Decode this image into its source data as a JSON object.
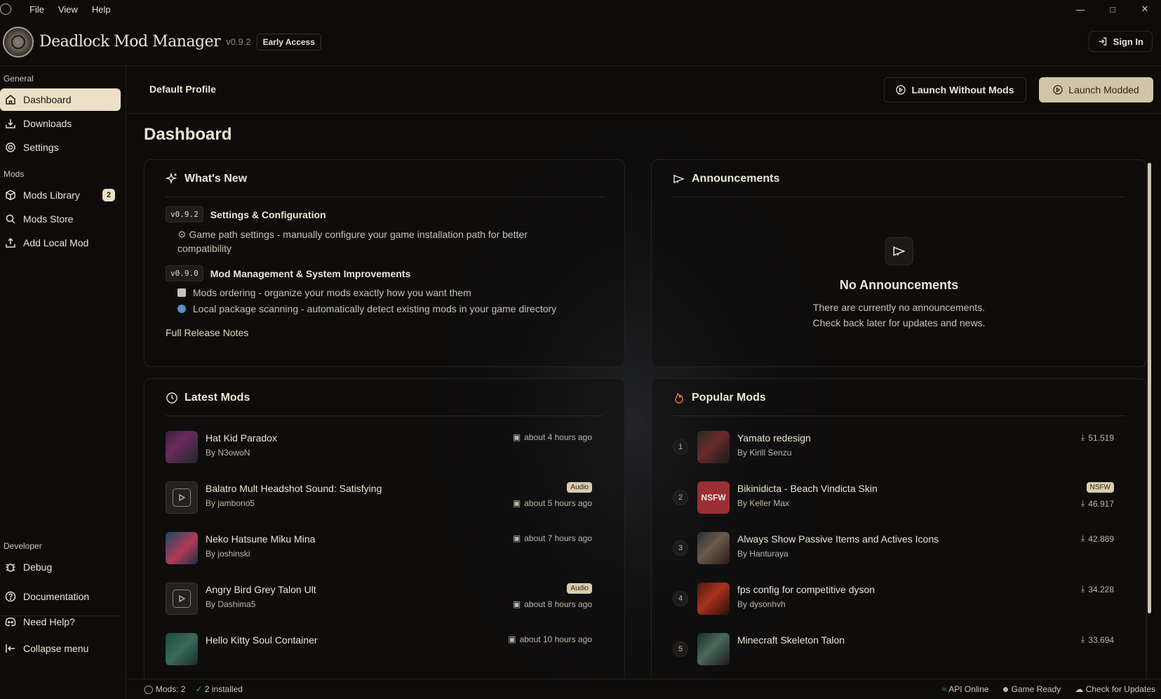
{
  "menu": {
    "file": "File",
    "view": "View",
    "help": "Help"
  },
  "header": {
    "title": "Deadlock Mod Manager",
    "version": "v0.9.2",
    "badge": "Early Access",
    "sign_in": "Sign In"
  },
  "sidebar": {
    "general_label": "General",
    "dashboard": "Dashboard",
    "downloads": "Downloads",
    "settings": "Settings",
    "mods_label": "Mods",
    "mods_library": "Mods Library",
    "mods_library_count": "2",
    "mods_store": "Mods Store",
    "add_local_mod": "Add Local Mod",
    "developer_label": "Developer",
    "debug": "Debug",
    "documentation": "Documentation",
    "need_help": "Need Help?",
    "collapse": "Collapse menu"
  },
  "profile": {
    "name": "Default Profile",
    "launch_without_mods": "Launch Without Mods",
    "launch_modded": "Launch Modded"
  },
  "page_title": "Dashboard",
  "whats_new": {
    "title": "What's New",
    "releases": [
      {
        "version": "v0.9.2",
        "title": "Settings & Configuration",
        "items": [
          "Game path settings - manually configure your game installation path for better compatibility"
        ]
      },
      {
        "version": "v0.9.0",
        "title": "Mod Management & System Improvements",
        "items": [
          "Mods ordering - organize your mods exactly how you want them",
          "Local package scanning - automatically detect existing mods in your game directory"
        ]
      }
    ],
    "link": "Full Release Notes"
  },
  "announcements": {
    "title": "Announcements",
    "empty_title": "No Announcements",
    "empty_line1": "There are currently no announcements.",
    "empty_line2": "Check back later for updates and news."
  },
  "latest_mods": {
    "title": "Latest Mods",
    "items": [
      {
        "name": "Hat Kid Paradox",
        "author": "By N3owoN",
        "time": "about 4 hours ago",
        "tag": ""
      },
      {
        "name": "Balatro Mult Headshot Sound: Satisfying",
        "author": "By jambono5",
        "time": "about 5 hours ago",
        "tag": "Audio"
      },
      {
        "name": "Neko Hatsune Miku Mina",
        "author": "By joshinski",
        "time": "about 7 hours ago",
        "tag": ""
      },
      {
        "name": "Angry Bird Grey Talon Ult",
        "author": "By Dashima5",
        "time": "about 8 hours ago",
        "tag": "Audio"
      },
      {
        "name": "Hello Kitty Soul Container",
        "author": "",
        "time": "about 10 hours ago",
        "tag": ""
      }
    ]
  },
  "popular_mods": {
    "title": "Popular Mods",
    "items": [
      {
        "rank": "1",
        "name": "Yamato redesign",
        "author": "By Kirill Senzu",
        "downloads": "51.519",
        "tag": ""
      },
      {
        "rank": "2",
        "name": "Bikinidicta - Beach Vindicta Skin",
        "author": "By Keller Max",
        "downloads": "46.917",
        "tag": "NSFW"
      },
      {
        "rank": "3",
        "name": "Always Show Passive Items and Actives Icons",
        "author": "By Hanturaya",
        "downloads": "42.889",
        "tag": ""
      },
      {
        "rank": "4",
        "name": "fps config for competitive dyson",
        "author": "By dysonhvh",
        "downloads": "34.228",
        "tag": ""
      },
      {
        "rank": "5",
        "name": "Minecraft Skeleton Talon",
        "author": "",
        "downloads": "33.694",
        "tag": ""
      }
    ],
    "nsfw_thumb_label": "NSFW"
  },
  "statusbar": {
    "mods": "Mods: 2",
    "installed": "2 installed",
    "api": "API Online",
    "game": "Game Ready",
    "updates": "Check for Updates"
  },
  "colors": {
    "accent": "#ece0c6",
    "button_primary": "#d2c4a6",
    "background": "#0d0c0b",
    "nsfw": "#9b2f34",
    "online": "#4caf50"
  }
}
